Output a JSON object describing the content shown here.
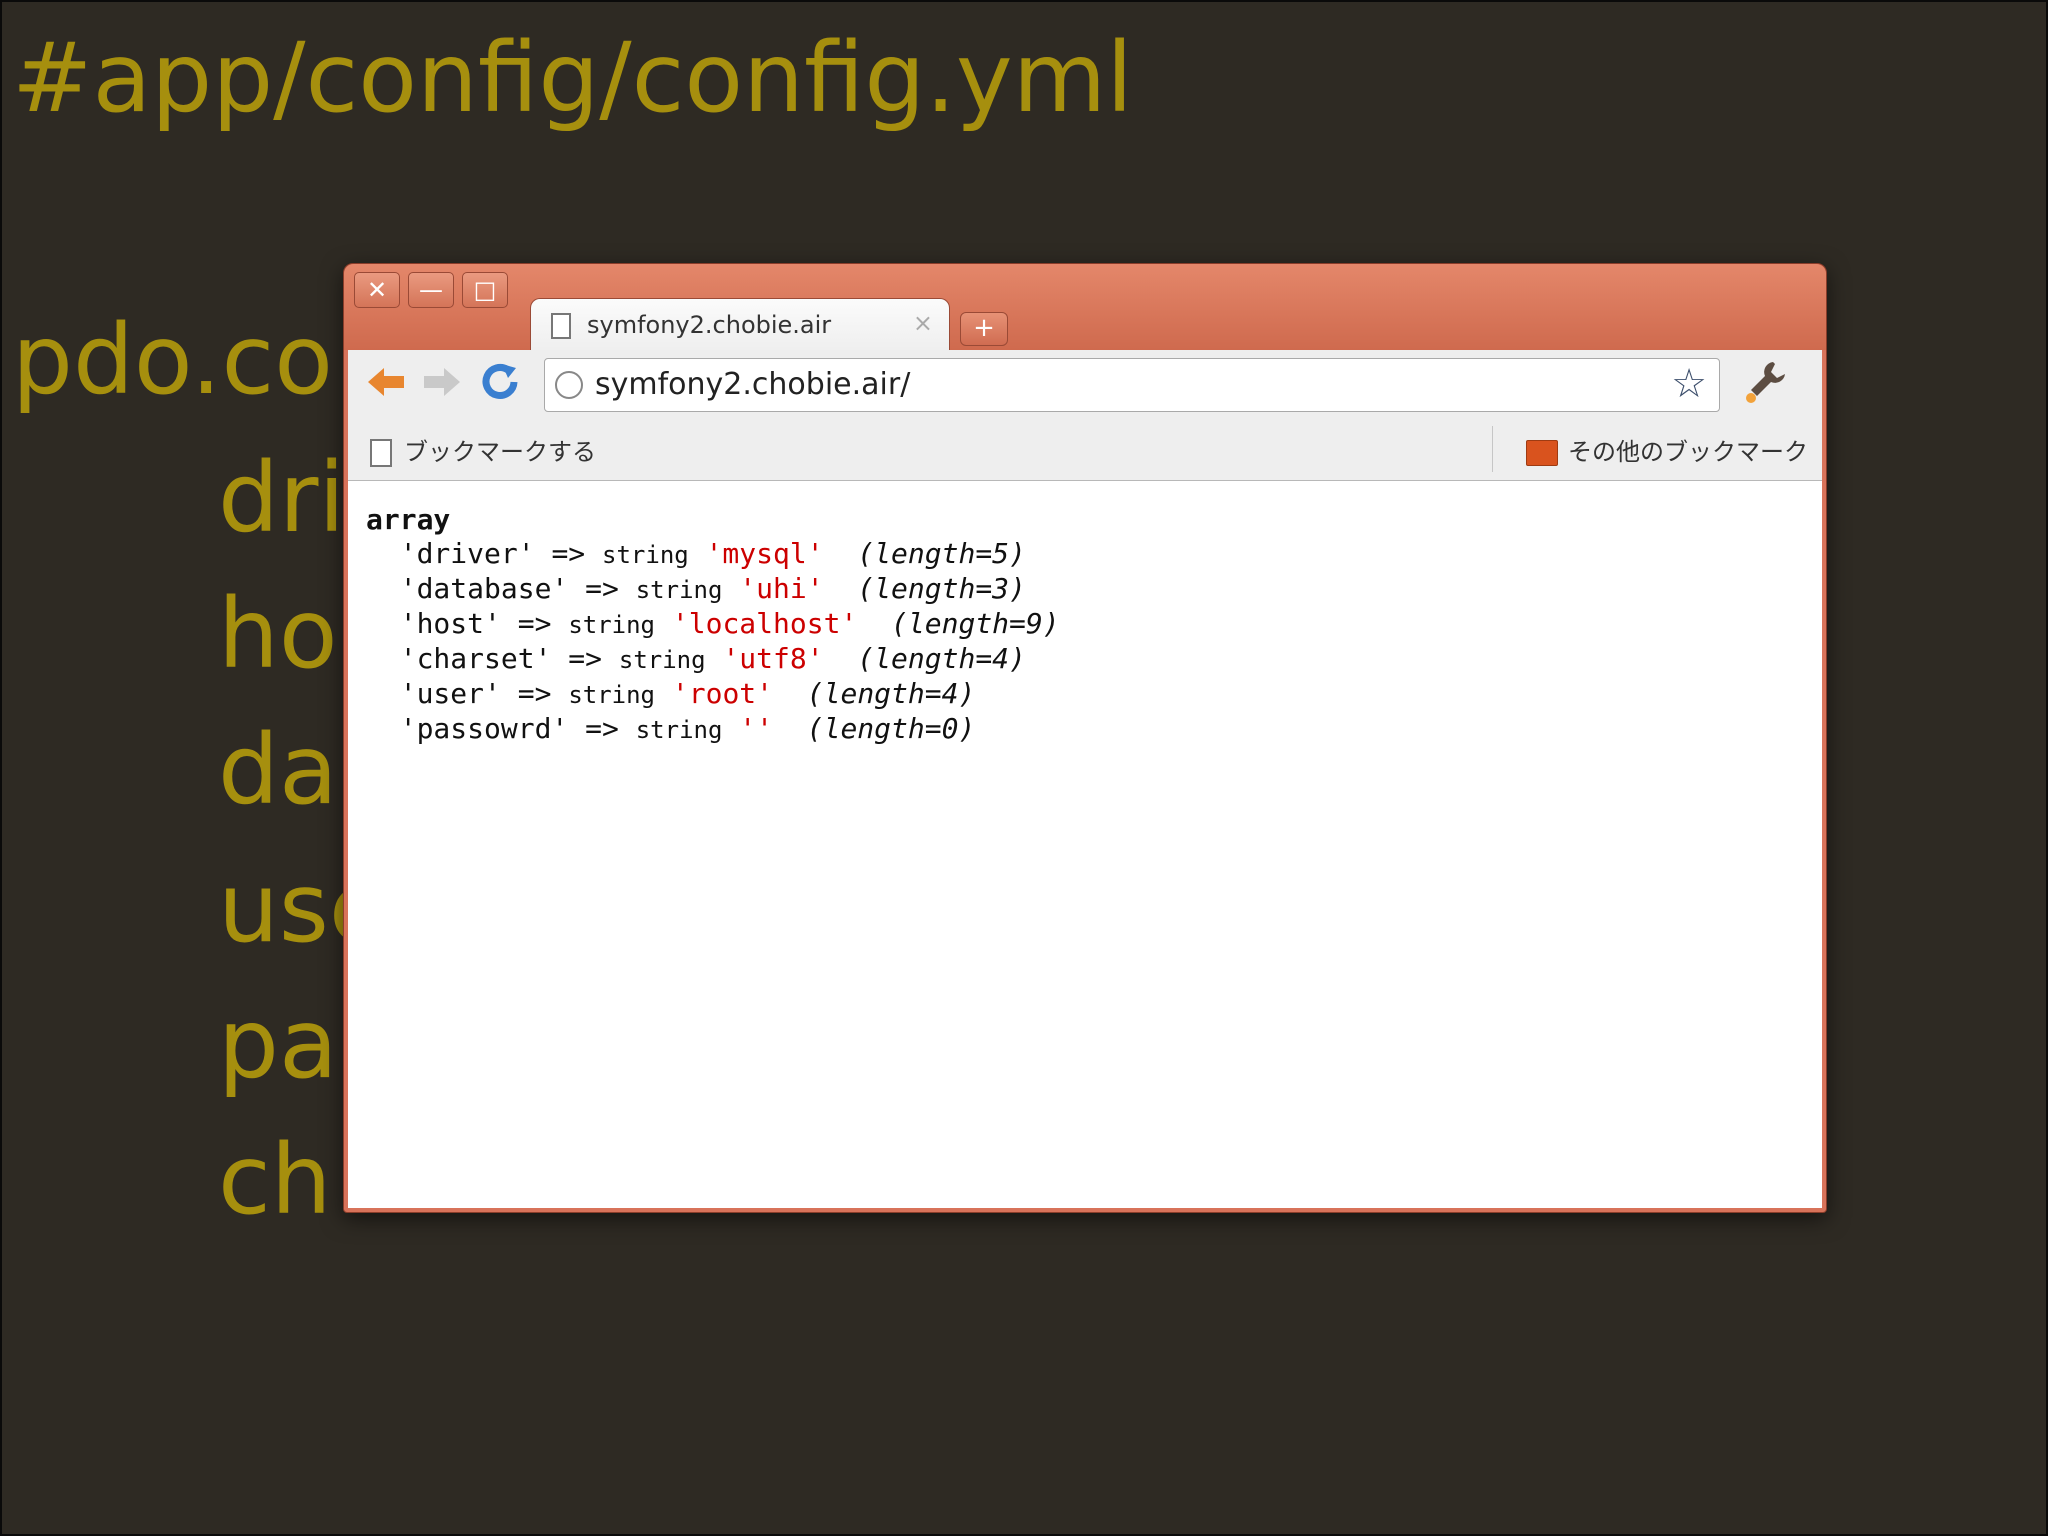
{
  "slide": {
    "title": "#app/config/config.yml",
    "lines": [
      "pdo.co",
      "dri",
      "ho",
      "da",
      "use",
      "pa",
      "ch"
    ]
  },
  "window": {
    "controls": {
      "close": "✕",
      "minimize": "—",
      "maximize": "□"
    },
    "tab_title": "symfony2.chobie.air",
    "tab_close": "×",
    "new_tab": "+",
    "url": "symfony2.chobie.air/",
    "bookmark_this": "ブックマークする",
    "other_bookmarks": "その他のブックマーク"
  },
  "icons": {
    "back": "back-arrow-icon",
    "forward": "forward-arrow-icon",
    "reload": "reload-icon",
    "star": "star-icon",
    "wrench": "wrench-icon"
  },
  "dump": {
    "header": "array",
    "rows": [
      {
        "key": "'driver'",
        "arrow": "=>",
        "type": "string",
        "value": "'mysql'",
        "length": "(length=5)"
      },
      {
        "key": "'database'",
        "arrow": "=>",
        "type": "string",
        "value": "'uhi'",
        "length": "(length=3)"
      },
      {
        "key": "'host'",
        "arrow": "=>",
        "type": "string",
        "value": "'localhost'",
        "length": "(length=9)"
      },
      {
        "key": "'charset'",
        "arrow": "=>",
        "type": "string",
        "value": "'utf8'",
        "length": "(length=4)"
      },
      {
        "key": "'user'",
        "arrow": "=>",
        "type": "string",
        "value": "'root'",
        "length": "(length=4)"
      },
      {
        "key": "'passowrd'",
        "arrow": "=>",
        "type": "string",
        "value": "''",
        "length": "(length=0)"
      }
    ]
  },
  "colors": {
    "slide_bg": "#2e2a23",
    "slide_text": "#a68f0e",
    "titlebar": "#d8735a",
    "dump_value": "#cc0000"
  }
}
